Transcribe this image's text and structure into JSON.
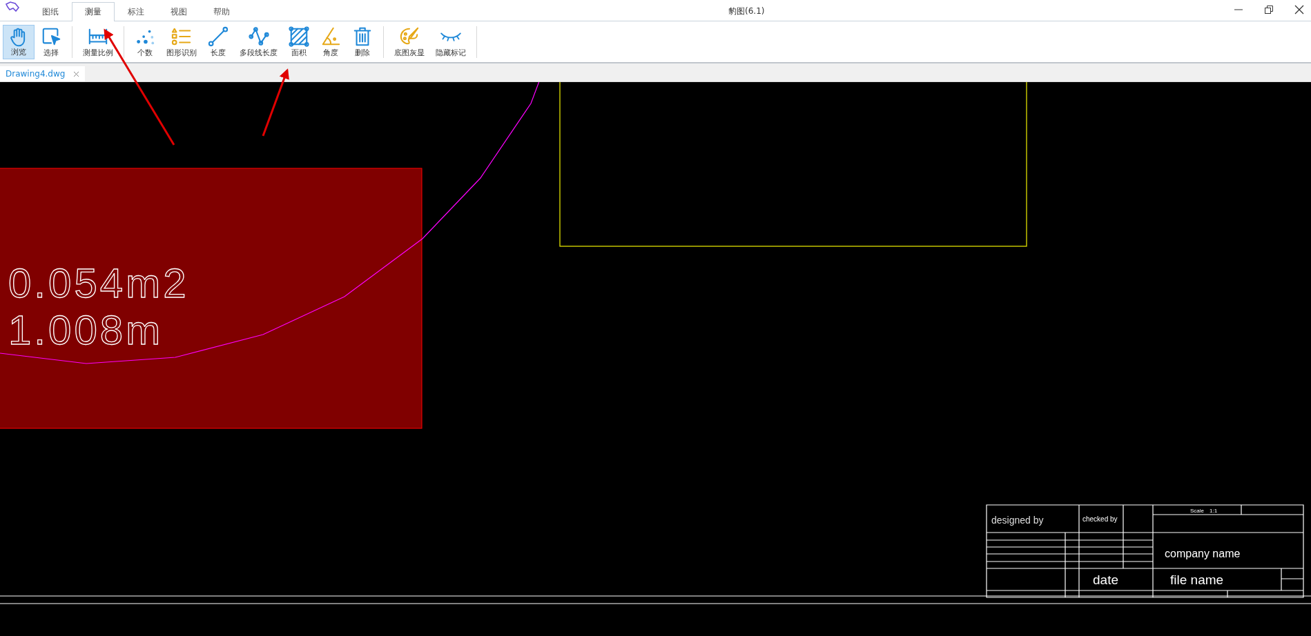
{
  "window": {
    "title": "豹图(6.1)"
  },
  "menu_tabs": [
    {
      "label": "图纸",
      "selected": false
    },
    {
      "label": "测量",
      "selected": true
    },
    {
      "label": "标注",
      "selected": false
    },
    {
      "label": "视图",
      "selected": false
    },
    {
      "label": "帮助",
      "selected": false
    }
  ],
  "toolbar": {
    "groups": [
      [
        {
          "label": "浏览",
          "kind": "hand",
          "selected": true
        },
        {
          "label": "选择",
          "kind": "select",
          "selected": false
        }
      ],
      [
        {
          "label": "测量比例",
          "kind": "ruler",
          "selected": false
        }
      ],
      [
        {
          "label": "个数",
          "kind": "dots",
          "selected": false
        },
        {
          "label": "图形识别",
          "kind": "list",
          "selected": false
        },
        {
          "label": "长度",
          "kind": "line",
          "selected": false
        },
        {
          "label": "多段线长度",
          "kind": "polyline",
          "selected": false
        },
        {
          "label": "面积",
          "kind": "area",
          "selected": false
        },
        {
          "label": "角度",
          "kind": "angle",
          "selected": false
        },
        {
          "label": "删除",
          "kind": "trash",
          "selected": false
        }
      ],
      [
        {
          "label": "底图灰显",
          "kind": "palette",
          "selected": false
        },
        {
          "label": "隐藏标记",
          "kind": "eye",
          "selected": false
        }
      ]
    ]
  },
  "document_tabs": [
    {
      "label": "Drawing4.dwg",
      "selected": true
    }
  ],
  "drawing": {
    "measurements": [
      "0.054m2",
      "1.008m"
    ],
    "title_block": {
      "designed_by": "designed by",
      "checked_by": "checked by",
      "scale_label": "Scale",
      "scale_value": "1:1",
      "company": "company name",
      "date": "date",
      "file_name": "file name"
    }
  }
}
